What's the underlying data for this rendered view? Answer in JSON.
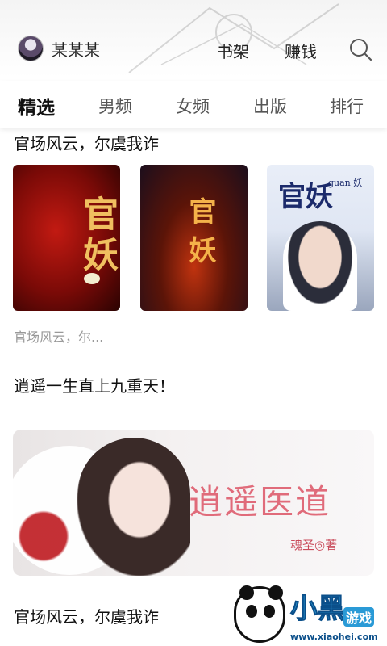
{
  "header": {
    "username": "某某某",
    "links": [
      "书架",
      "赚钱"
    ],
    "search_icon": "search-icon",
    "avatar_icon": "user-avatar"
  },
  "tabs": [
    "精选",
    "男频",
    "女频",
    "出版",
    "排行"
  ],
  "active_tab": "精选",
  "sections": {
    "first_title": "官场风云，尔虞我诈",
    "books": [
      {
        "cover_title": "官妖",
        "cover_sub": ""
      },
      {
        "cover_title": "官妖",
        "cover_sub": ""
      },
      {
        "cover_title": "官妖",
        "cover_sub": "guan 妖"
      }
    ],
    "book_caption": "官场风云，尔...",
    "second_title": "逍遥一生直上九重天！",
    "banner": {
      "title": "逍遥医道",
      "author": "魂圣◎著"
    },
    "third_title": "官场风云，尔虞我诈"
  },
  "watermark": {
    "brand": "小黑",
    "tag": "游戏",
    "url": "www.xiaohei.com"
  },
  "colors": {
    "active_tab": "#111111",
    "inactive_tab": "#555555",
    "caption": "#999999",
    "banner_title": "#e06b7a"
  }
}
